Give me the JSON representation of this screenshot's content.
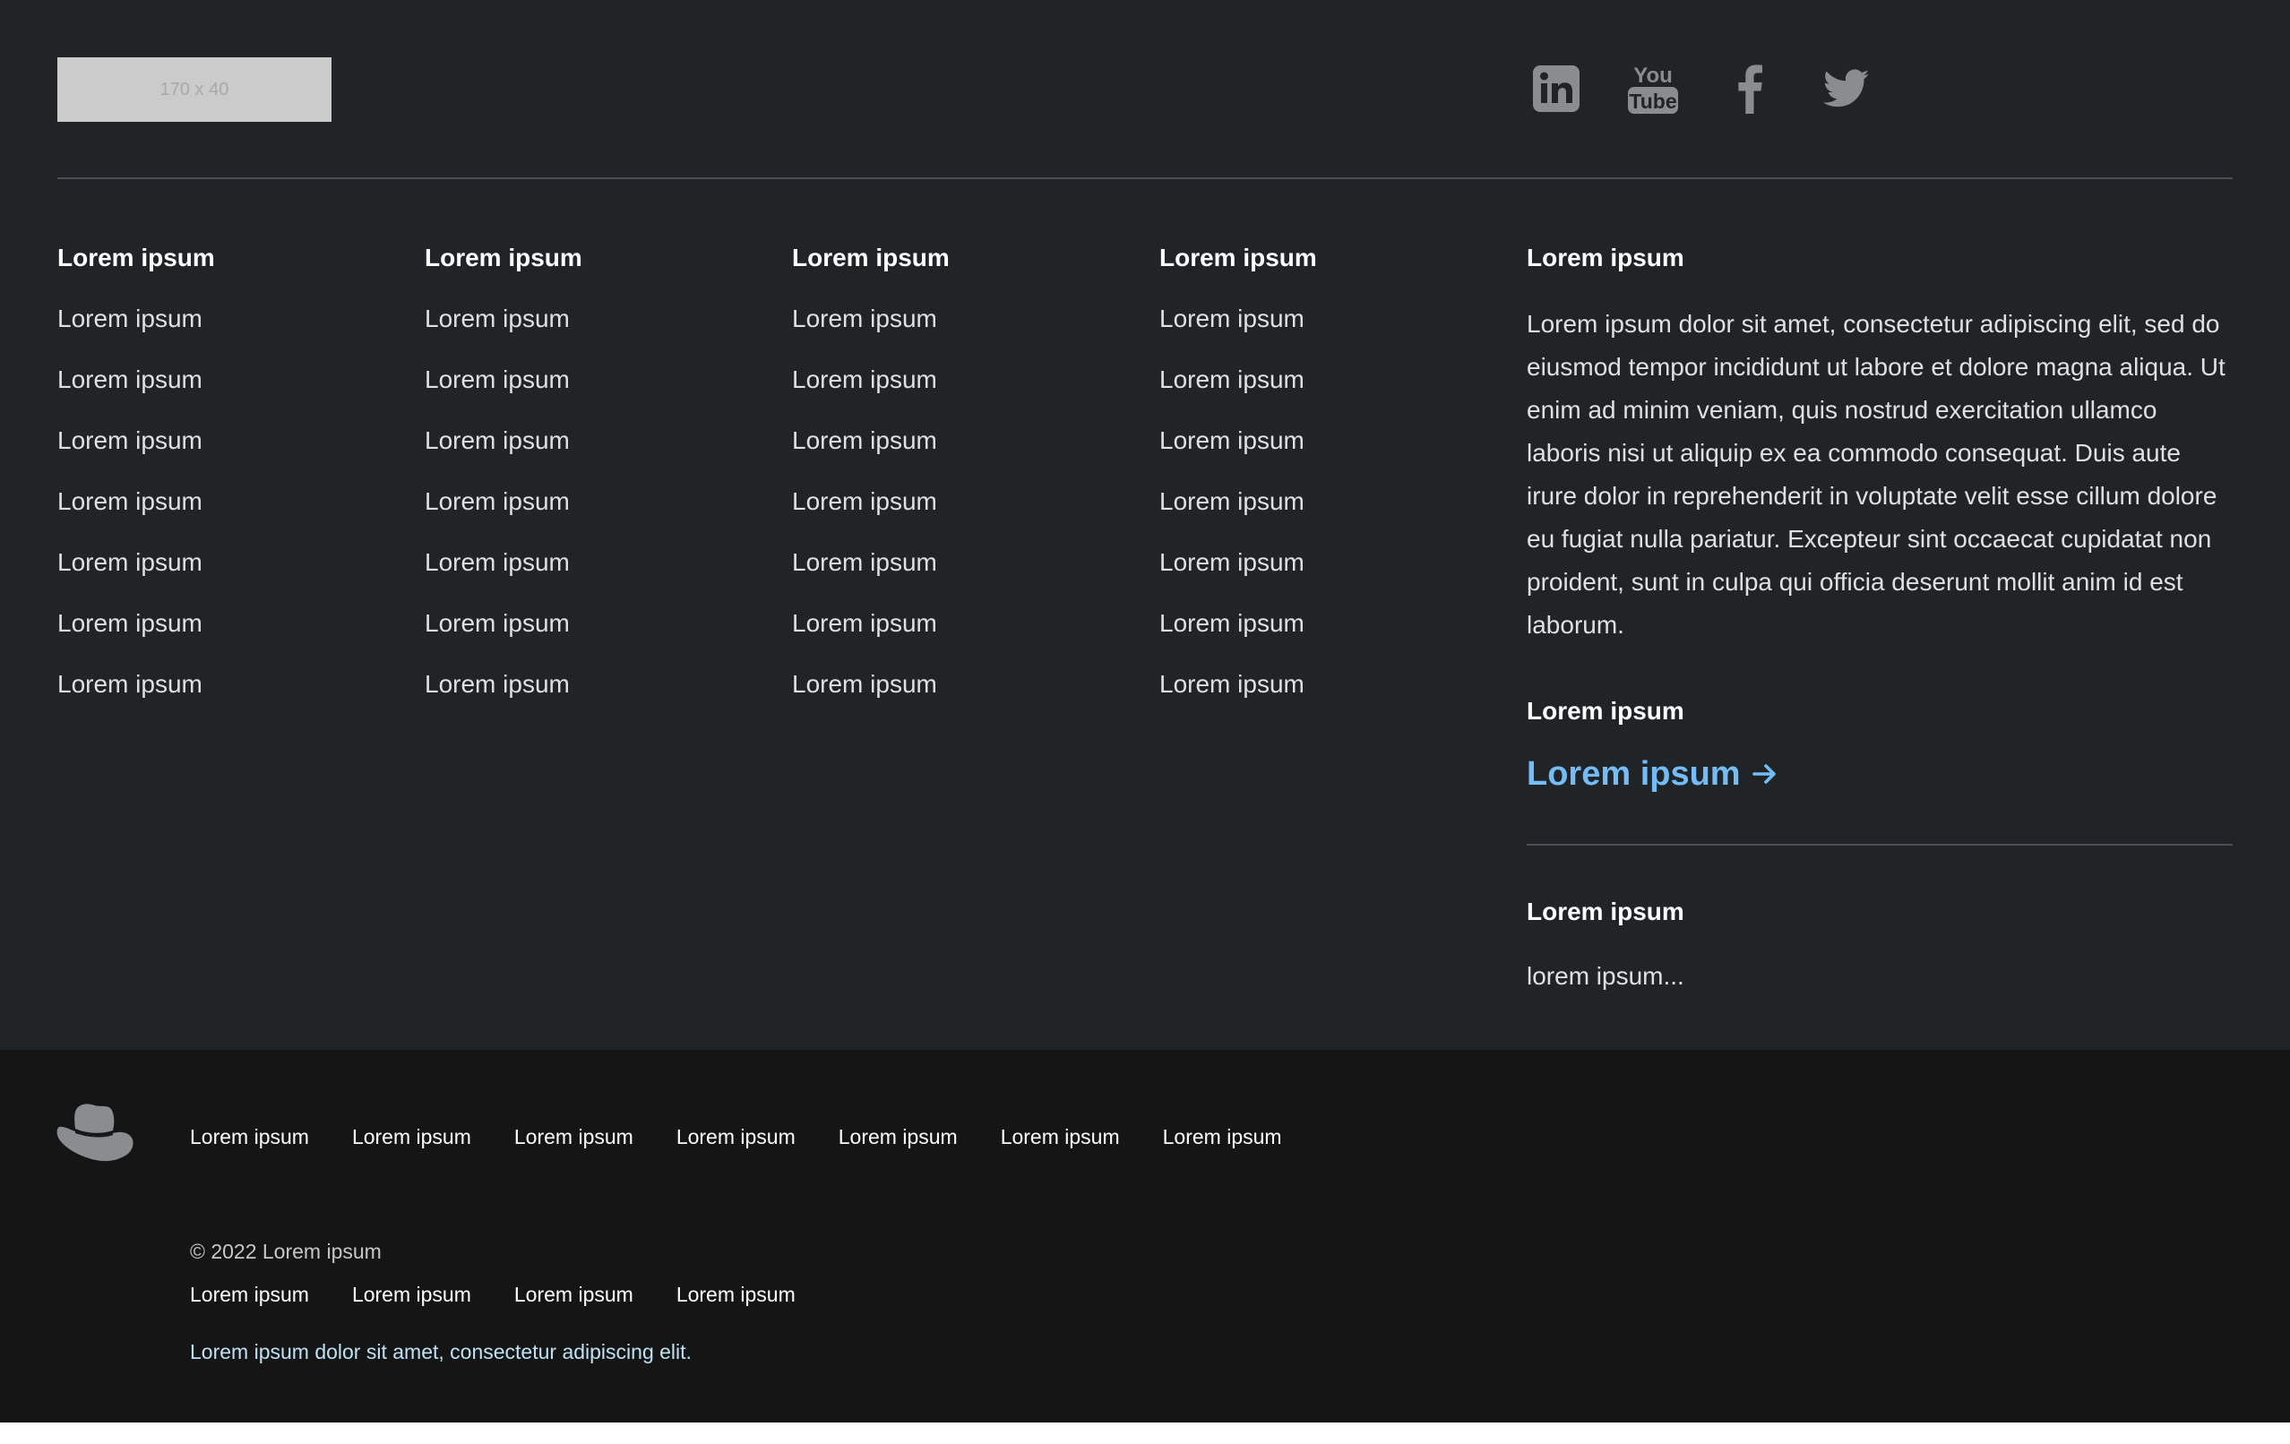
{
  "brand": {
    "logo_placeholder": "170 x 40"
  },
  "social": [
    {
      "name": "LinkedIn",
      "icon": "linkedin-icon"
    },
    {
      "name": "YouTube",
      "icon": "youtube-icon",
      "line1": "You",
      "line2": "Tube"
    },
    {
      "name": "Facebook",
      "icon": "facebook-icon"
    },
    {
      "name": "Twitter",
      "icon": "twitter-icon"
    }
  ],
  "columns": [
    {
      "heading": "Lorem ipsum",
      "links": [
        "Lorem ipsum",
        "Lorem ipsum",
        "Lorem ipsum",
        "Lorem ipsum",
        "Lorem ipsum",
        "Lorem ipsum",
        "Lorem ipsum"
      ]
    },
    {
      "heading": "Lorem ipsum",
      "links": [
        "Lorem ipsum",
        "Lorem ipsum",
        "Lorem ipsum",
        "Lorem ipsum",
        "Lorem ipsum",
        "Lorem ipsum",
        "Lorem ipsum"
      ]
    },
    {
      "heading": "Lorem ipsum",
      "links": [
        "Lorem ipsum",
        "Lorem ipsum",
        "Lorem ipsum",
        "Lorem ipsum",
        "Lorem ipsum",
        "Lorem ipsum",
        "Lorem ipsum"
      ]
    },
    {
      "heading": "Lorem ipsum",
      "links": [
        "Lorem ipsum",
        "Lorem ipsum",
        "Lorem ipsum",
        "Lorem ipsum",
        "Lorem ipsum",
        "Lorem ipsum",
        "Lorem ipsum"
      ]
    }
  ],
  "about": {
    "heading": "Lorem ipsum",
    "text": "Lorem ipsum dolor sit amet, consectetur adipiscing elit, sed do eiusmod tempor incididunt ut labore et dolore magna aliqua. Ut enim ad minim veniam, quis nostrud exercitation ullamco laboris nisi ut aliquip ex ea commodo consequat. Duis aute irure dolor in reprehenderit in voluptate velit esse cillum dolore eu fugiat nulla pariatur. Excepteur sint occaecat cupidatat non proident, sunt in culpa qui officia deserunt mollit anim id est laborum.",
    "cta_heading": "Lorem ipsum",
    "cta_label": "Lorem ipsum",
    "status_heading": "Lorem ipsum",
    "status_text": "lorem ipsum..."
  },
  "bottom": {
    "nav": [
      "Lorem ipsum",
      "Lorem ipsum",
      "Lorem ipsum",
      "Lorem ipsum",
      "Lorem ipsum",
      "Lorem ipsum",
      "Lorem ipsum"
    ],
    "copyright": "© 2022 Lorem ipsum",
    "legal": [
      "Lorem ipsum",
      "Lorem ipsum",
      "Lorem ipsum",
      "Lorem ipsum"
    ],
    "tagline": "Lorem ipsum dolor sit amet, consectetur adipiscing elit."
  },
  "colors": {
    "primary_bg": "#212427",
    "secondary_bg": "#151515",
    "accent_link": "#73bcf7",
    "tagline": "#bee1f4",
    "icon_gray": "#8a8d90",
    "hat_gray": "#8a8d90"
  }
}
